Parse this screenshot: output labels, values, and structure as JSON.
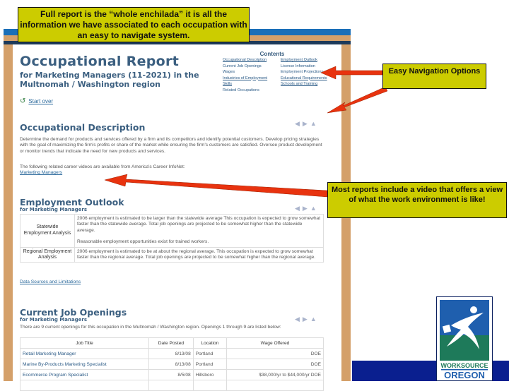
{
  "callouts": {
    "top": "Full report is the “whole enchilada” it is all the information we have associated to each occupation with an easy to navigate system.",
    "nav": "Easy Navigation Options",
    "video": "Most reports include a video that offers a view of what the work environment is like!"
  },
  "report": {
    "title": "Occupational Report",
    "subtitle": "for Marketing Managers (11-2021) in the Multnomah / Washington region",
    "start_over": "Start over",
    "contents": {
      "heading": "Contents",
      "items": [
        {
          "label": "Occupational Description",
          "link": true
        },
        {
          "label": "Employment Outlook",
          "link": true
        },
        {
          "label": "Current Job Openings",
          "link": false
        },
        {
          "label": "License Information",
          "link": false
        },
        {
          "label": "Wages",
          "link": false
        },
        {
          "label": "Employment Projections",
          "link": false
        },
        {
          "label": "Industries of Employment",
          "link": true
        },
        {
          "label": "Educational Requirements",
          "link": true
        },
        {
          "label": "Skills",
          "link": true
        },
        {
          "label": "Schools and Training",
          "link": true
        },
        {
          "label": "Related Occupations",
          "link": false
        }
      ]
    },
    "nav_arrows": {
      "prev": "◀",
      "next": "▶",
      "up": "▲"
    },
    "description": {
      "heading": "Occupational Description",
      "text": "Determine the demand for products and services offered by a firm and its competitors and identify potential customers. Develop pricing strategies with the goal of maximizing the firm's profits or share of the market while ensuring the firm's customers are satisfied. Oversee product development or monitor trends that indicate the need for new products and services.",
      "video_intro": "The following related career videos are available from America's Career InfoNet:",
      "video_link": "Marketing Managers"
    },
    "outlook": {
      "heading": "Employment Outlook",
      "sub": "for Marketing Managers",
      "rows": [
        {
          "label": "Statewide Employment Analysis",
          "text": "2006 employment is estimated to be larger than the statewide average This occupation is expected to grow somewhat faster than the statewide average. Total job openings are projected to be somewhat higher than the statewide average.",
          "extra": "Reasonable employment opportunities exist for trained workers."
        },
        {
          "label": "Regional Employment Analysis",
          "text": "2006 employment is estimated to be at about the regional average. This occupation is expected to grow somewhat faster than the regional average. Total job openings are projected to be somewhat higher than the regional average.",
          "extra": ""
        }
      ],
      "sources_link": "Data Sources and Limitations"
    },
    "jobs": {
      "heading": "Current Job Openings",
      "sub": "for Marketing Managers",
      "intro": "There are 9 current openings for this occupation in the Multnomah / Washington region. Openings 1 through 9 are listed below:",
      "columns": [
        "Job Title",
        "Date Posted",
        "Location",
        "Wage Offered"
      ],
      "rows": [
        [
          "Retail Marketing Manager",
          "8/13/08",
          "Portland",
          "DOE"
        ],
        [
          "Marine By-Products Marketing Specialist",
          "8/13/08",
          "Portland",
          "DOE"
        ],
        [
          "Ecommerce Program Specialist",
          "8/5/08",
          "Hillsboro",
          "$38,000/yr to $44,000/yr DOE"
        ]
      ]
    }
  },
  "logo": {
    "line1": "WORKSOURCE",
    "line2": "OREGON"
  },
  "colors": {
    "callout": "#cccc00",
    "arrow": "#e8330f",
    "heading": "#3b5f80",
    "frame_tan": "#d4a06a",
    "frame_blue": "#1a6fb8",
    "footer_navy": "#0a1f8f",
    "logo_green": "#1e7a5a",
    "logo_blue": "#1f5fae"
  }
}
